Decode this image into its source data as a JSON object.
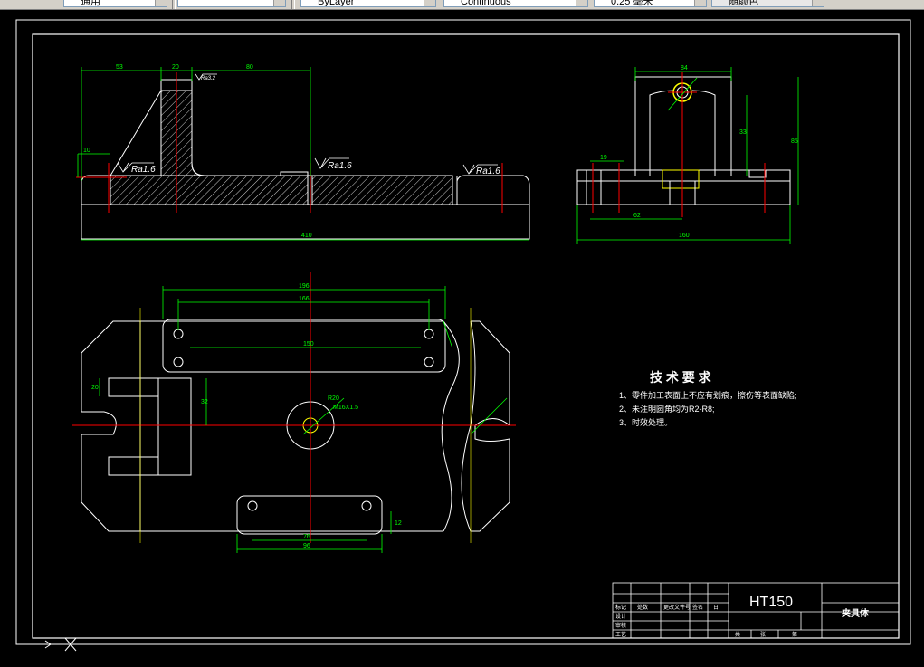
{
  "toolbar": {
    "text_style": "通用",
    "layer": "",
    "linetype": "ByLayer",
    "lineweight_type": "Continuous",
    "lineweight": "0.25 毫米",
    "plot_style": "随颜色"
  },
  "drawing": {
    "tech_title": "技 术 要 求",
    "tech_lines": [
      "1、零件加工表面上不应有划痕，擦伤等表面缺陷;",
      "2、未注明圆角均为R2-R8;",
      "3、时效处理。"
    ],
    "roughness": [
      "Ra1.6",
      "Ra1.6",
      "Ra1.6",
      "Ra3.2"
    ],
    "dims": {
      "top_left": "53",
      "top_mid": "20",
      "top_right": "80",
      "overall_width": "410",
      "left_height": "10",
      "side_width": "84",
      "side_height": "33",
      "side_total": "85",
      "side_base": "19",
      "side_bottom": "62",
      "side_overall": "160",
      "plan_w1": "196",
      "plan_w2": "166",
      "plan_w3": "150",
      "plan_w4": "76",
      "plan_w5": "96",
      "plan_r": "R20",
      "hole_note": "M16X1.5",
      "side_dim": "20",
      "plan_h": "32",
      "plan_small": "12"
    },
    "title_block": {
      "material": "HT150",
      "part_name": "夹具体",
      "headers": [
        "标记",
        "处数",
        "更改文件号",
        "签名",
        "日"
      ],
      "rows": [
        "设计",
        "审核",
        "工艺"
      ],
      "scale_labels": [
        "共",
        "张",
        "第"
      ]
    }
  },
  "colors": {
    "background": "#000000",
    "outline": "#ffffff",
    "dimension": "#00ff00",
    "centerline": "#ff0000",
    "hatch": "#ffffff",
    "yellow": "#ffff00"
  }
}
